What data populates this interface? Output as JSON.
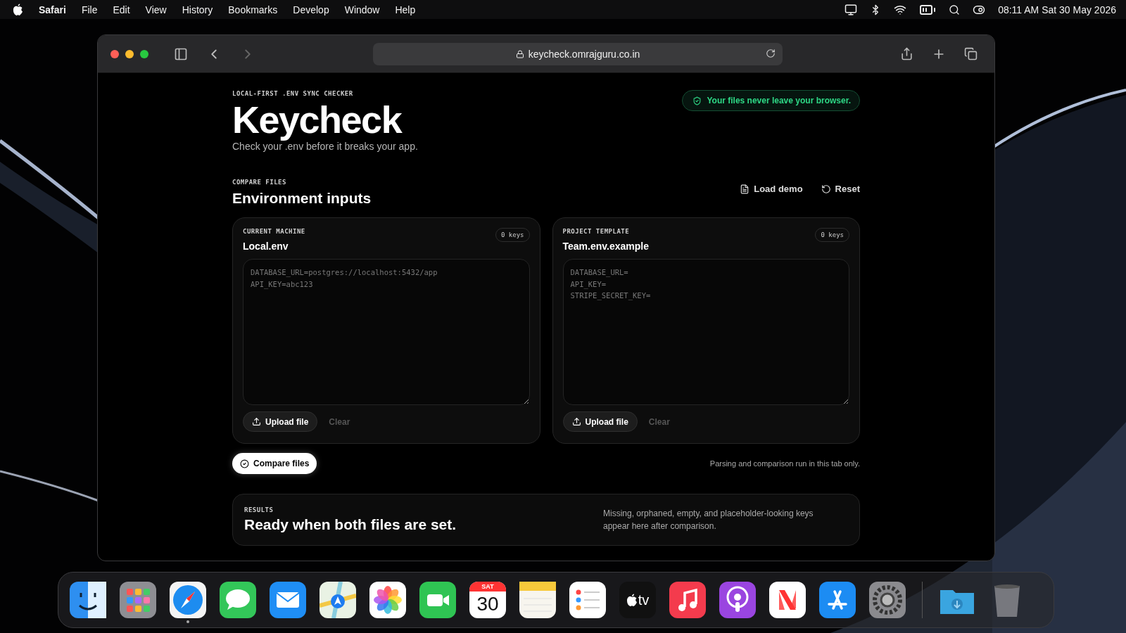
{
  "menu_bar": {
    "app": "Safari",
    "items": [
      "File",
      "Edit",
      "View",
      "History",
      "Bookmarks",
      "Develop",
      "Window",
      "Help"
    ],
    "clock": "08:11 AM Sat 30 May 2026"
  },
  "browser": {
    "url": "keycheck.omrajguru.co.in",
    "back_disabled": false,
    "forward_disabled": true
  },
  "page": {
    "eyebrow": "LOCAL-FIRST .ENV SYNC CHECKER",
    "title": "Keycheck",
    "subtitle": "Check your .env before it breaks your app.",
    "privacy_badge": "Your files never leave your browser.",
    "section_eyebrow": "COMPARE FILES",
    "section_title": "Environment inputs",
    "actions": [
      {
        "kind": "demo",
        "label": "Load demo"
      },
      {
        "kind": "reset",
        "label": "Reset"
      }
    ],
    "panels": [
      {
        "eyebrow": "CURRENT MACHINE",
        "title": "Local.env",
        "count": "0 keys",
        "placeholder": "DATABASE_URL=postgres://localhost:5432/app\nAPI_KEY=abc123",
        "upload": "Upload file",
        "clear": "Clear",
        "clear_disabled": true
      },
      {
        "eyebrow": "PROJECT TEMPLATE",
        "title": "Team.env.example",
        "count": "0 keys",
        "placeholder": "DATABASE_URL=\nAPI_KEY=\nSTRIPE_SECRET_KEY=",
        "upload": "Upload file",
        "clear": "Clear",
        "clear_disabled": true
      }
    ],
    "compare_button": "Compare files",
    "note": "Parsing and comparison run in this tab only.",
    "results": {
      "eyebrow": "RESULTS",
      "title": "Ready when both files are set.",
      "description": "Missing, orphaned, empty, and placeholder-looking keys appear here after comparison."
    }
  },
  "dock": [
    {
      "kind": "finder",
      "running": false
    },
    {
      "kind": "launchpad",
      "running": false
    },
    {
      "kind": "safari",
      "running": true
    },
    {
      "kind": "messages",
      "running": false
    },
    {
      "kind": "mail",
      "running": false
    },
    {
      "kind": "maps",
      "running": false
    },
    {
      "kind": "photos",
      "running": false
    },
    {
      "kind": "facetime",
      "running": false
    },
    {
      "kind": "calendar",
      "running": false,
      "day": "SAT",
      "date": "30"
    },
    {
      "kind": "notes",
      "running": false
    },
    {
      "kind": "reminders",
      "running": false
    },
    {
      "kind": "tv",
      "running": false,
      "label": "tv"
    },
    {
      "kind": "music",
      "running": false
    },
    {
      "kind": "podcasts",
      "running": false
    },
    {
      "kind": "news",
      "running": false
    },
    {
      "kind": "appstore",
      "running": false
    },
    {
      "kind": "settings",
      "running": false
    },
    {
      "kind": "separator"
    },
    {
      "kind": "downloads",
      "running": false
    },
    {
      "kind": "trash",
      "running": false
    }
  ]
}
